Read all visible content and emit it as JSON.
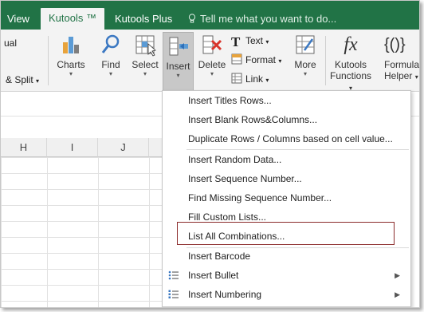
{
  "tabs": {
    "view": "View",
    "kutools": "Kutools ™",
    "kutools_plus": "Kutools Plus",
    "tell_me": "Tell me what you want to do..."
  },
  "ribbon": {
    "partial_top": "ual",
    "partial_split": "& Split",
    "charts": "Charts",
    "find": "Find",
    "select": "Select",
    "insert": "Insert",
    "delete": "Delete",
    "text": "Text",
    "format": "Format",
    "link": "Link",
    "more": "More",
    "kutools_functions_1": "Kutools",
    "kutools_functions_2": "Functions",
    "formula_helper_1": "Formula",
    "formula_helper_2": "Helper",
    "fx_glyph": "fx",
    "braces_glyph": "{()}"
  },
  "columns": [
    "H",
    "I",
    "J"
  ],
  "menu": {
    "items": [
      "Insert Titles Rows...",
      "Insert Blank Rows&Columns...",
      "Duplicate Rows / Columns based on cell value...",
      "Insert Random Data...",
      "Insert Sequence Number...",
      "Find Missing Sequence Number...",
      "Fill Custom Lists...",
      "List All Combinations...",
      "Insert Barcode",
      "Insert Bullet",
      "Insert Numbering"
    ],
    "highlighted_item": "List All Combinations..."
  },
  "colors": {
    "ribbon_tab_bar": "#217346",
    "highlight_border": "#8b2b2b"
  }
}
